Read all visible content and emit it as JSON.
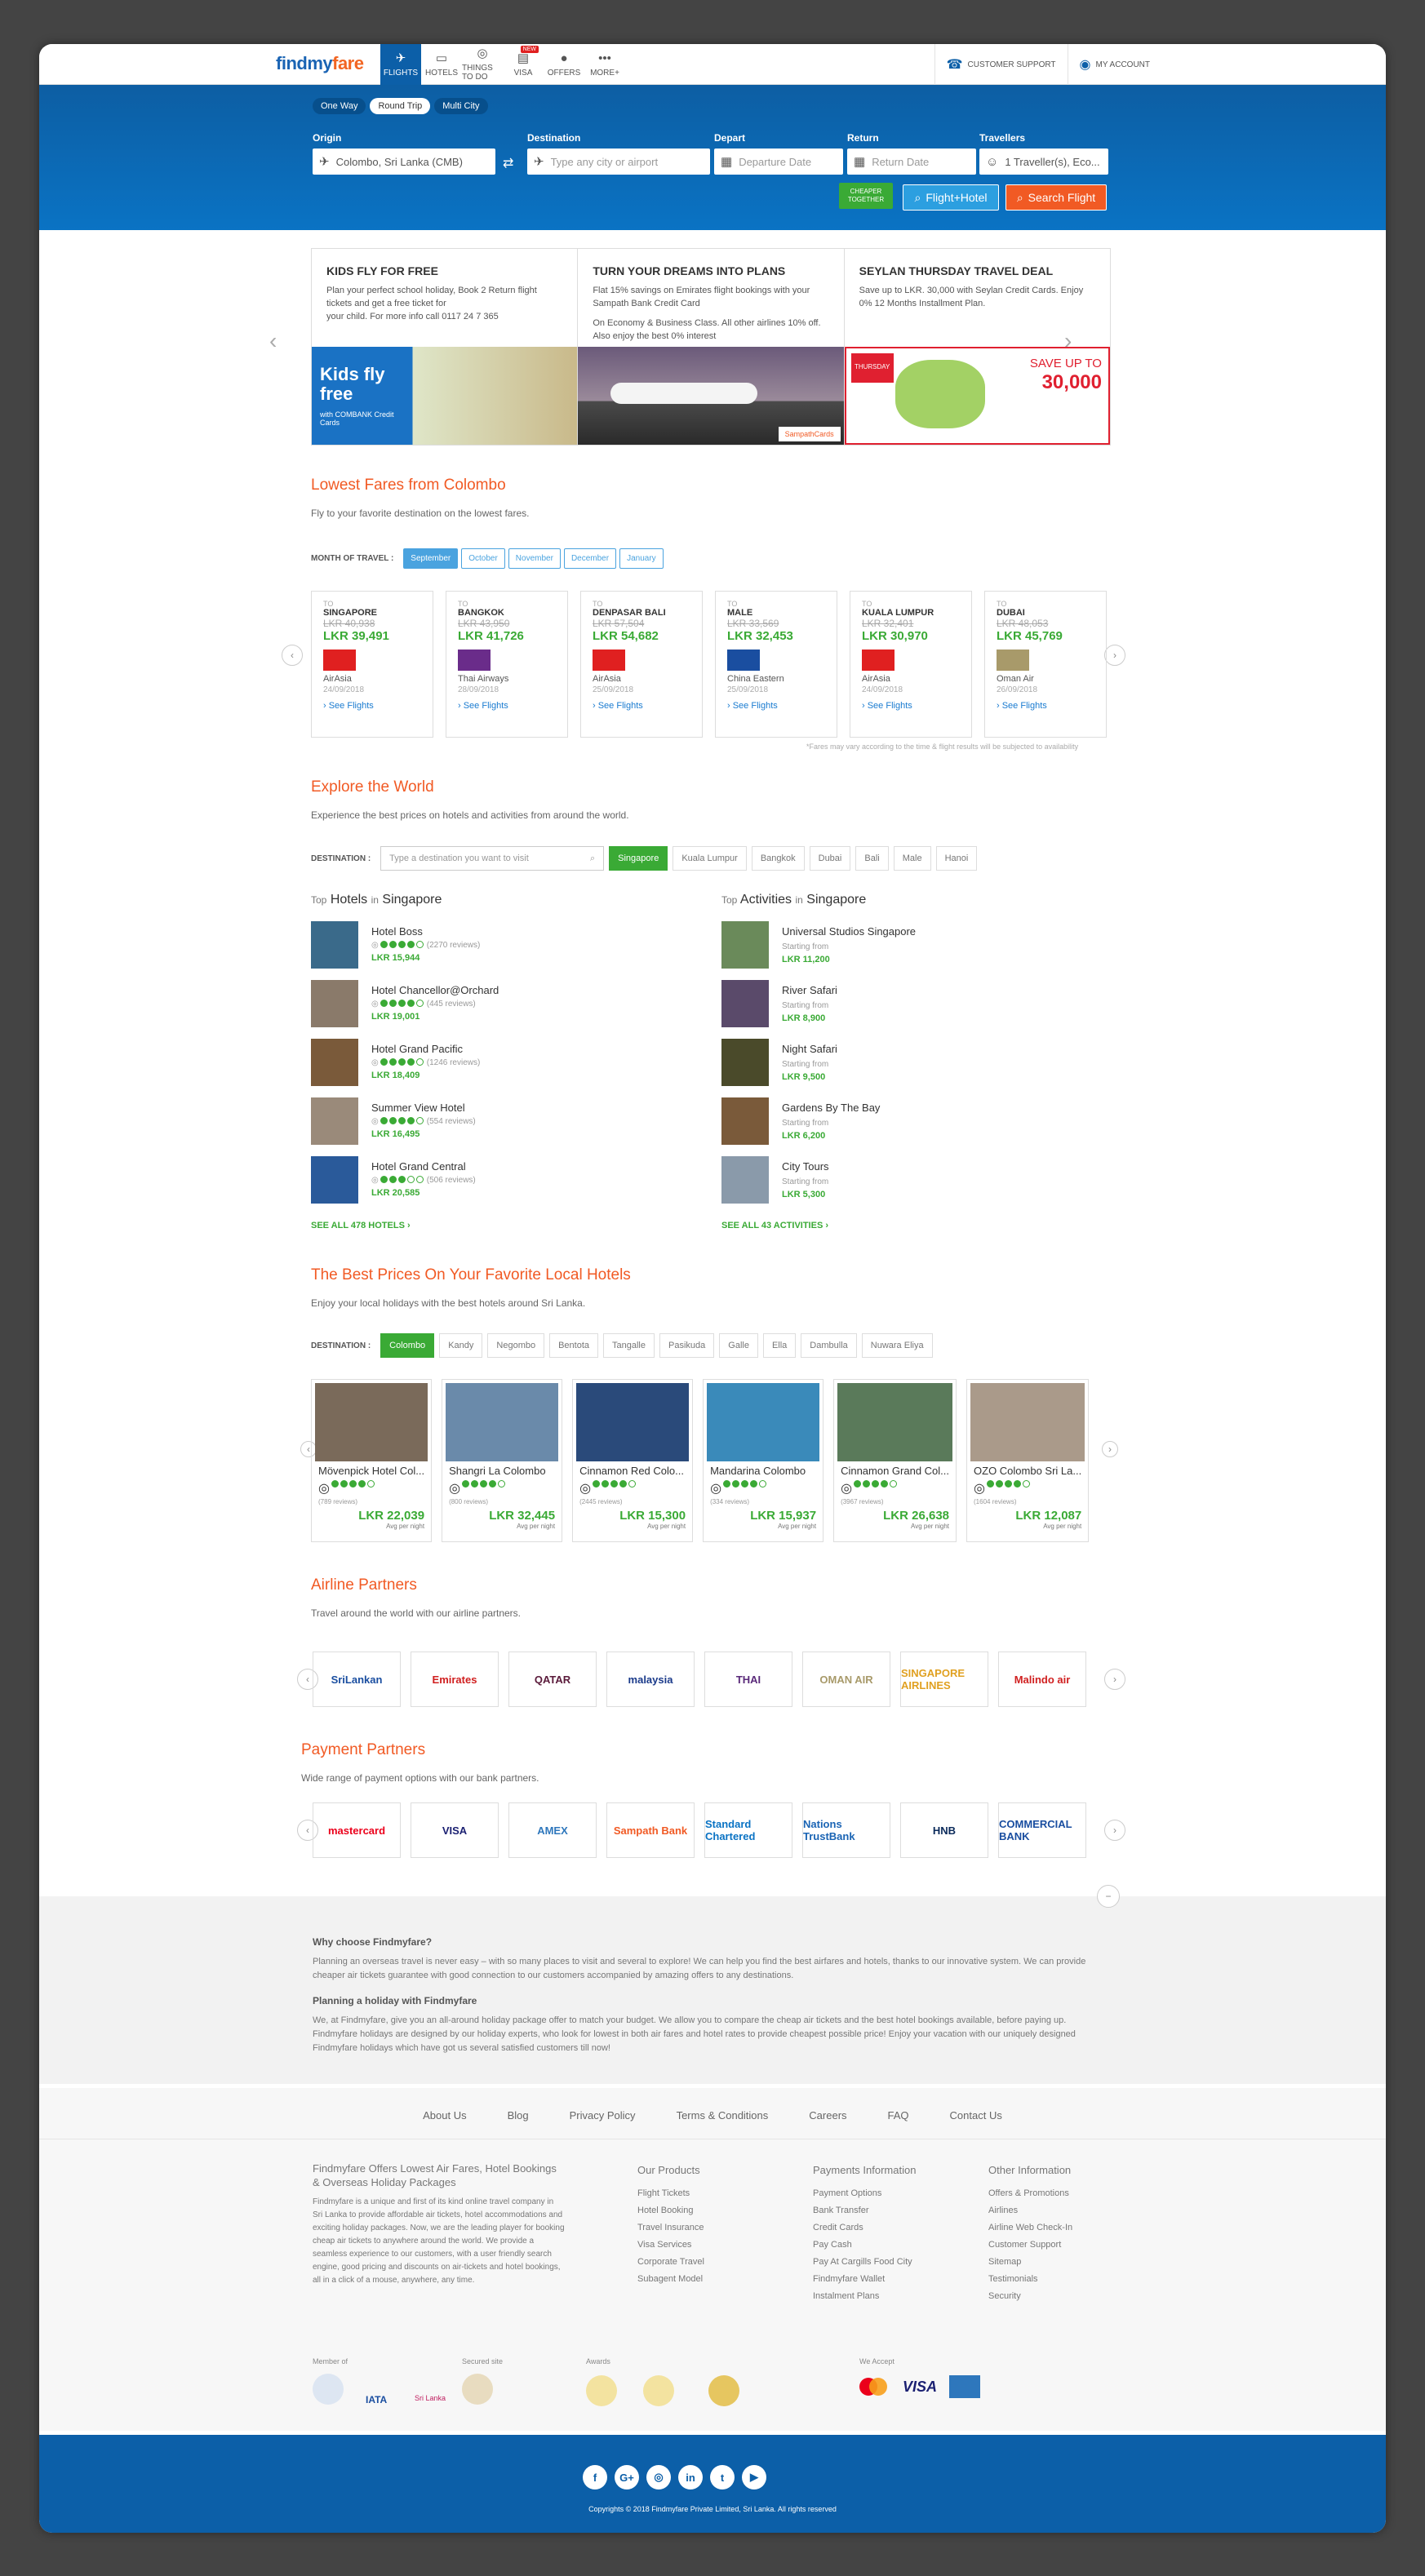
{
  "brand": {
    "find": "findmy",
    "fare": "fare"
  },
  "nav": [
    {
      "label": "FLIGHTS",
      "icon": "plane-icon",
      "glyph": "✈"
    },
    {
      "label": "HOTELS",
      "icon": "bed-icon",
      "glyph": "▭"
    },
    {
      "label": "THINGS TO DO",
      "icon": "binoculars-icon",
      "glyph": "◎"
    },
    {
      "label": "VISA",
      "icon": "passport-icon",
      "glyph": "▤",
      "badge": "NEW"
    },
    {
      "label": "OFFERS",
      "icon": "tag-icon",
      "glyph": "●"
    },
    {
      "label": "MORE+",
      "icon": "dots-icon",
      "glyph": "•••"
    }
  ],
  "support": "CUSTOMER SUPPORT",
  "account": "MY ACCOUNT",
  "trip": {
    "one": "One Way",
    "round": "Round Trip",
    "multi": "Multi City"
  },
  "search": {
    "origin_label": "Origin",
    "origin_value": "Colombo, Sri Lanka (CMB)",
    "dest_label": "Destination",
    "dest_ph": "Type any city or airport",
    "depart_label": "Depart",
    "depart_ph": "Departure Date",
    "return_label": "Return",
    "return_ph": "Return Date",
    "trav_label": "Travellers",
    "trav_value": "1 Traveller(s), Eco...",
    "cheaper": "CHEAPER TOGETHER",
    "flight_hotel": "Flight+Hotel",
    "search_flight": "Search Flight"
  },
  "promos": [
    {
      "title": "KIDS FLY FOR FREE",
      "text": "Plan your perfect school holiday, Book 2 Return flight tickets and get a free ticket for",
      "text2": "your child. For more info call 0117 24 7 365",
      "banner": "Kids fly free",
      "banner2": "with COMBANK Credit Cards"
    },
    {
      "title": "TURN YOUR DREAMS INTO PLANS",
      "text": "Flat 15% savings on Emirates flight bookings with your Sampath Bank Credit Card",
      "text2": "On Economy & Business Class. All other airlines 10% off. Also enjoy the best 0% interest",
      "banner": "SampathCards"
    },
    {
      "title": "SEYLAN THURSDAY TRAVEL DEAL",
      "text": "Save up to LKR. 30,000 with Seylan Credit Cards. Enjoy 0% 12 Months Installment Plan.",
      "text2": "",
      "banner": "SAVE UP TO",
      "banner2": "30,000",
      "banner3": "THURSDAY"
    }
  ],
  "lowest": {
    "title": "Lowest Fares from Colombo",
    "sub": "Fly to your favorite destination on the lowest fares.",
    "month_label": "MONTH OF TRAVEL :",
    "months": [
      "September",
      "October",
      "November",
      "December",
      "January"
    ],
    "note": "*Fares may vary according to the time & flight results will be subjected to availability",
    "to": "TO",
    "see": "› See Flights",
    "fares": [
      {
        "city": "SINGAPORE",
        "old": "LKR 40,938",
        "new": "LKR 39,491",
        "airline": "AirAsia",
        "date": "24/09/2018",
        "color": "#e02020"
      },
      {
        "city": "BANGKOK",
        "old": "LKR 43,950",
        "new": "LKR 41,726",
        "airline": "Thai Airways",
        "date": "28/09/2018",
        "color": "#6a2c8a"
      },
      {
        "city": "DENPASAR BALI",
        "old": "LKR 57,504",
        "new": "LKR 54,682",
        "airline": "AirAsia",
        "date": "25/09/2018",
        "color": "#e02020"
      },
      {
        "city": "MALE",
        "old": "LKR 33,569",
        "new": "LKR 32,453",
        "airline": "China Eastern",
        "date": "25/09/2018",
        "color": "#1a4ea0"
      },
      {
        "city": "KUALA LUMPUR",
        "old": "LKR 32,401",
        "new": "LKR 30,970",
        "airline": "AirAsia",
        "date": "24/09/2018",
        "color": "#e02020"
      },
      {
        "city": "DUBAI",
        "old": "LKR 48,053",
        "new": "LKR 45,769",
        "airline": "Oman Air",
        "date": "26/09/2018",
        "color": "#a89a6a"
      }
    ]
  },
  "explore": {
    "title": "Explore the World",
    "sub": "Experience the best prices on hotels and activities from around the world.",
    "dest_label": "DESTINATION :",
    "dest_ph": "Type a destination you want to visit",
    "chips": [
      "Singapore",
      "Kuala Lumpur",
      "Bangkok",
      "Dubai",
      "Bali",
      "Male",
      "Hanoi"
    ],
    "top": "Top",
    "hotels_in": "Hotels",
    "activities_in": "Activities",
    "in": "in",
    "city": "Singapore",
    "hotels": [
      {
        "name": "Hotel Boss",
        "reviews": "(2270 reviews)",
        "price": "LKR 15,944",
        "stars": 4,
        "color": "#3a6a8a"
      },
      {
        "name": "Hotel Chancellor@Orchard",
        "reviews": "(445 reviews)",
        "price": "LKR 19,001",
        "stars": 4,
        "color": "#8a7a6a"
      },
      {
        "name": "Hotel Grand Pacific",
        "reviews": "(1246 reviews)",
        "price": "LKR 18,409",
        "stars": 4,
        "color": "#7a5a3a"
      },
      {
        "name": "Summer View Hotel",
        "reviews": "(554 reviews)",
        "price": "LKR 16,495",
        "stars": 4,
        "color": "#9a8a7a"
      },
      {
        "name": "Hotel Grand Central",
        "reviews": "(506 reviews)",
        "price": "LKR 20,585",
        "stars": 3,
        "color": "#2a5a9a"
      }
    ],
    "starting": "Starting from",
    "activities": [
      {
        "name": "Universal Studios Singapore",
        "price": "LKR 11,200",
        "color": "#6a8a5a"
      },
      {
        "name": "River Safari",
        "price": "LKR 8,900",
        "color": "#5a4a6a"
      },
      {
        "name": "Night Safari",
        "price": "LKR 9,500",
        "color": "#4a4a2a"
      },
      {
        "name": "Gardens By The Bay",
        "price": "LKR 6,200",
        "color": "#7a5a3a"
      },
      {
        "name": "City Tours",
        "price": "LKR 5,300",
        "color": "#8a9aaa"
      }
    ],
    "see_hotels": "SEE ALL 478 HOTELS  ›",
    "see_acts": "SEE ALL 43 ACTIVITIES  ›"
  },
  "local": {
    "title": "The Best Prices On Your Favorite Local Hotels",
    "sub": "Enjoy your local holidays with the best hotels around Sri Lanka.",
    "dest_label": "DESTINATION :",
    "chips": [
      "Colombo",
      "Kandy",
      "Negombo",
      "Bentota",
      "Tangalle",
      "Pasikuda",
      "Galle",
      "Ella",
      "Dambulla",
      "Nuwara Eliya"
    ],
    "avg": "Avg per night",
    "hotels": [
      {
        "name": "Mövenpick Hotel Col...",
        "reviews": "(789 reviews)",
        "price": "LKR 22,039",
        "color": "#7a6a5a"
      },
      {
        "name": "Shangri La Colombo",
        "reviews": "(800 reviews)",
        "price": "LKR 32,445",
        "color": "#6a8aaa"
      },
      {
        "name": "Cinnamon Red Colo...",
        "reviews": "(2445 reviews)",
        "price": "LKR 15,300",
        "color": "#2a4a7a"
      },
      {
        "name": "Mandarina Colombo",
        "reviews": "(334 reviews)",
        "price": "LKR 15,937",
        "color": "#3a8aba"
      },
      {
        "name": "Cinnamon Grand Col...",
        "reviews": "(3967 reviews)",
        "price": "LKR 26,638",
        "color": "#5a7a5a"
      },
      {
        "name": "OZO Colombo Sri La...",
        "reviews": "(1604 reviews)",
        "price": "LKR 12,087",
        "color": "#aa9a8a"
      }
    ]
  },
  "airlines": {
    "title": "Airline Partners",
    "sub": "Travel around the world with our airline partners.",
    "items": [
      {
        "n": "SriLankan",
        "c": "#1a4ea0"
      },
      {
        "n": "Emirates",
        "c": "#d02020"
      },
      {
        "n": "QATAR",
        "c": "#5a1a3a"
      },
      {
        "n": "malaysia",
        "c": "#1a3a8a"
      },
      {
        "n": "THAI",
        "c": "#5a2a7a"
      },
      {
        "n": "OMAN AIR",
        "c": "#a89a6a"
      },
      {
        "n": "SINGAPORE AIRLINES",
        "c": "#e0a020"
      },
      {
        "n": "Malindo air",
        "c": "#d02020"
      }
    ]
  },
  "payments": {
    "title": "Payment Partners",
    "sub": "Wide range of payment options with our bank partners.",
    "items": [
      {
        "n": "mastercard",
        "c": "#eb001b"
      },
      {
        "n": "VISA",
        "c": "#1a1f71"
      },
      {
        "n": "AMEX",
        "c": "#2e77bc"
      },
      {
        "n": "Sampath Bank",
        "c": "#f15a24"
      },
      {
        "n": "Standard Chartered",
        "c": "#0a73c4"
      },
      {
        "n": "Nations TrustBank",
        "c": "#1a64b4"
      },
      {
        "n": "HNB",
        "c": "#0a2a5a"
      },
      {
        "n": "COMMERCIAL BANK",
        "c": "#1a4ea0"
      }
    ]
  },
  "why": {
    "h1": "Why choose Findmyfare?",
    "p1": "Planning an overseas travel is never easy – with so many places to visit and several to explore! We can help you find the best airfares and hotels, thanks to our innovative system. We can provide cheaper air tickets guarantee with good connection to our customers accompanied by amazing offers to any destinations.",
    "h2": "Planning a holiday with Findmyfare",
    "p2": "We, at Findmyfare, give you an all-around holiday package offer to match your budget. We allow you to compare the cheap air tickets and the best hotel bookings available, before paying up. Findmyfare holidays are designed by our holiday experts, who look for lowest in both air fares and hotel rates to provide cheapest possible price! Enjoy your vacation with our uniquely designed Findmyfare holidays which have got us several satisfied customers till now!"
  },
  "footer": {
    "links": [
      "About Us",
      "Blog",
      "Privacy Policy",
      "Terms & Conditions",
      "Careers",
      "FAQ",
      "Contact Us"
    ],
    "about_title": "Findmyfare Offers Lowest Air Fares, Hotel Bookings & Overseas Holiday Packages",
    "about": "Findmyfare is a unique and first of its kind online travel company in Sri Lanka to provide affordable air tickets, hotel accommodations and exciting holiday packages. Now, we are the leading player for booking cheap air tickets to anywhere around the world. We provide a seamless experience to our customers, with a user friendly search engine, good pricing and discounts on air-tickets and hotel bookings, all in a click of a mouse, anywhere, any time.",
    "cols": [
      {
        "t": "Our Products",
        "i": [
          "Flight Tickets",
          "Hotel Booking",
          "Travel Insurance",
          "Visa Services",
          "Corporate Travel",
          "Subagent Model"
        ]
      },
      {
        "t": "Payments Information",
        "i": [
          "Payment Options",
          "Bank Transfer",
          "Credit Cards",
          "Pay Cash",
          "Pay At Cargills Food City",
          "Findmyfare Wallet",
          "Instalment Plans"
        ]
      },
      {
        "t": "Other Information",
        "i": [
          "Offers & Promotions",
          "Airlines",
          "Airline Web Check-In",
          "Customer Support",
          "Sitemap",
          "Testimonials",
          "Security"
        ]
      }
    ],
    "member": "Member of",
    "secured": "Secured site",
    "awards": "Awards",
    "accept": "We Accept",
    "iata": "IATA",
    "srilanka": "Sri Lanka",
    "visa": "VISA",
    "copyright": "Copyrights © 2018 Findmyfare Private Limited, Sri Lanka. All rights reserved"
  }
}
